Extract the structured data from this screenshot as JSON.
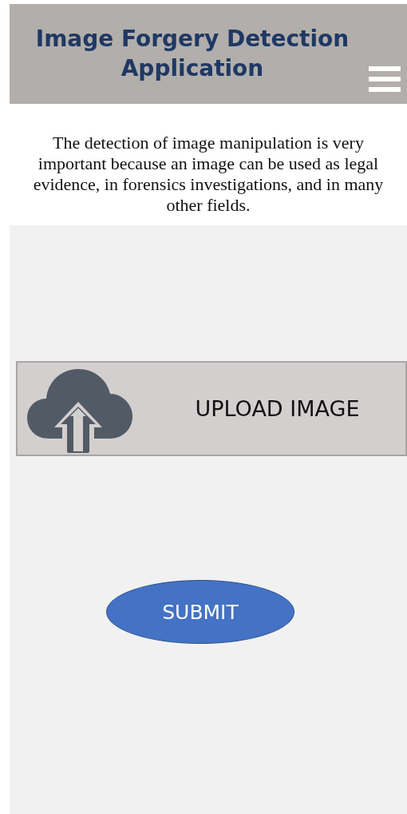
{
  "header": {
    "title": "Image Forgery Detection Application"
  },
  "description": "The detection of image manipulation is very important because an image can be used as legal evidence, in forensics investigations, and in many other fields.",
  "upload": {
    "label": "UPLOAD IMAGE"
  },
  "submit": {
    "label": "SUBMIT"
  }
}
